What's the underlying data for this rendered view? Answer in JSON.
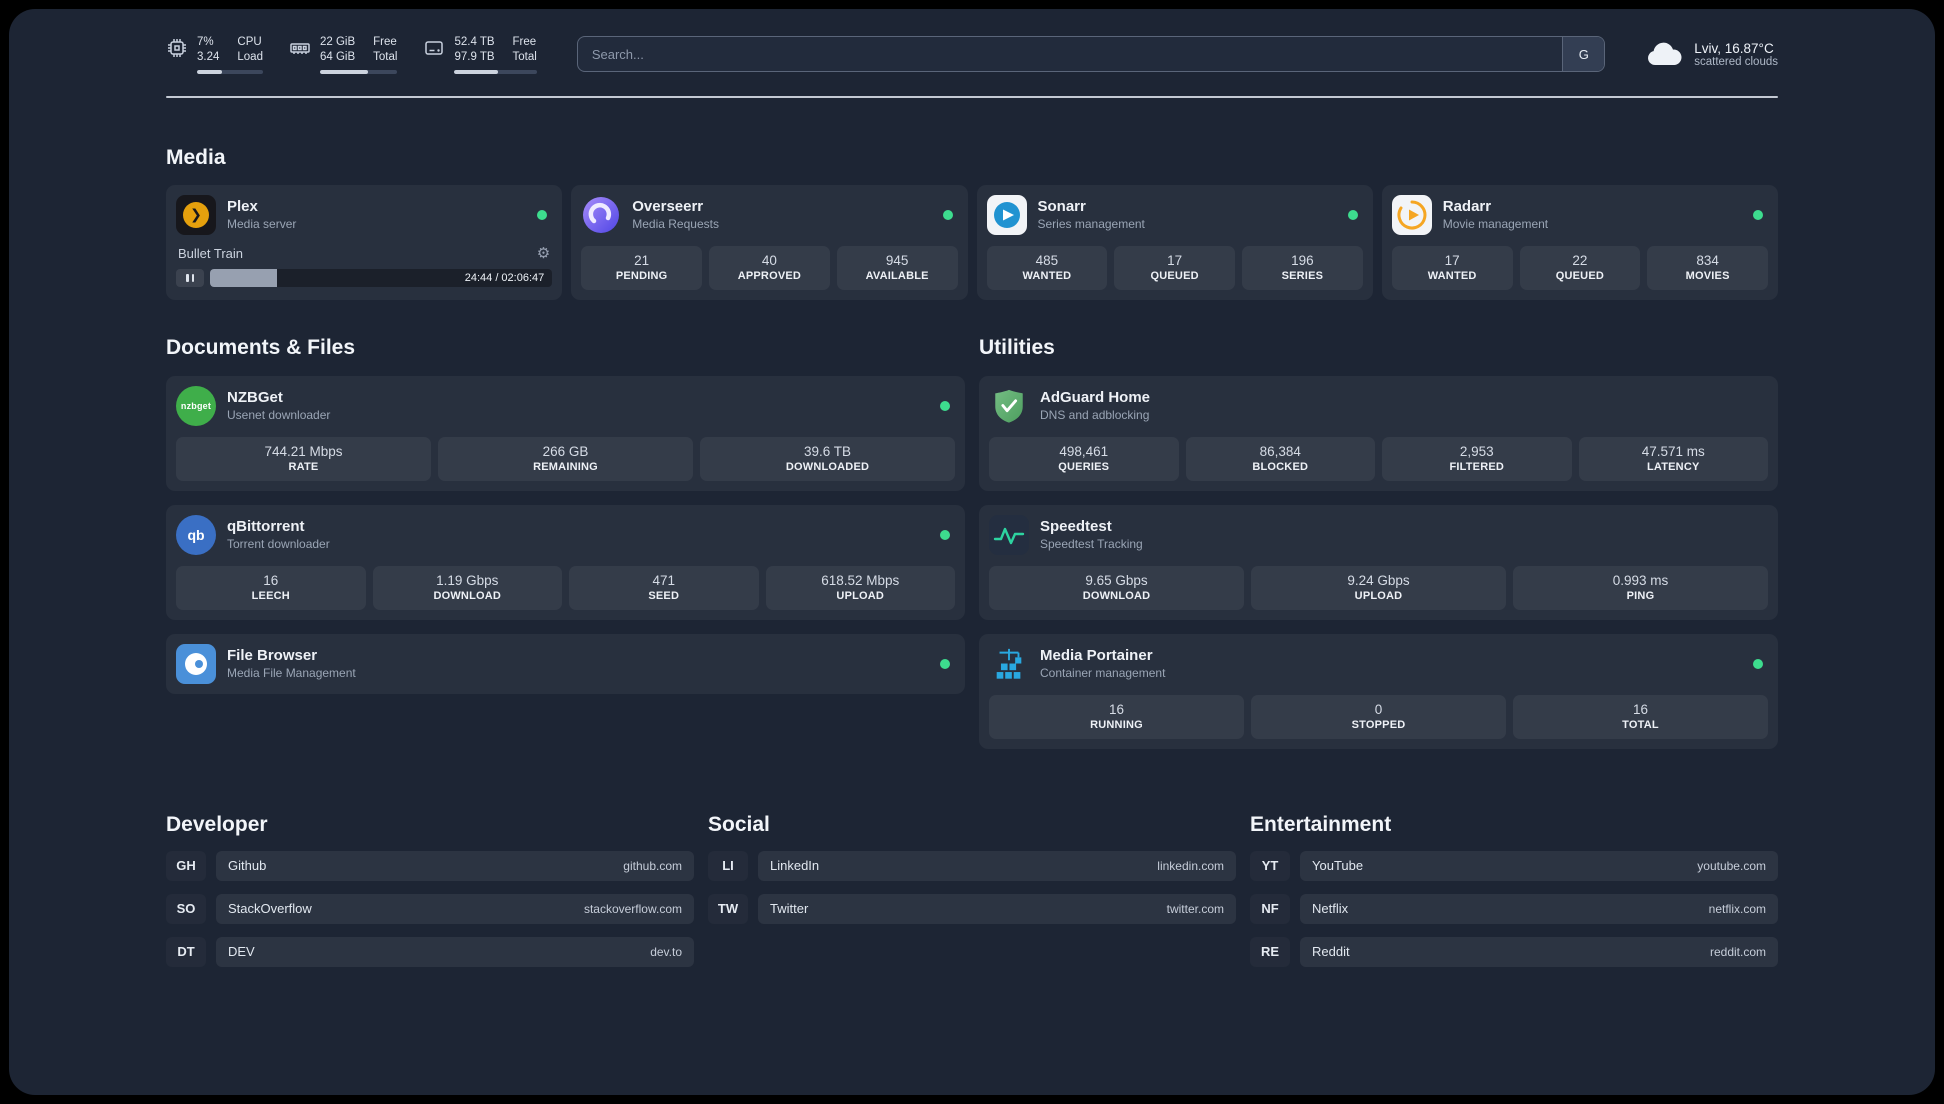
{
  "topbar": {
    "resources": [
      {
        "icon": "cpu-icon",
        "val1": "7%",
        "val2": "3.24",
        "lab1": "CPU",
        "lab2": "Load",
        "progress": 38
      },
      {
        "icon": "memory-icon",
        "val1": "22 GiB",
        "val2": "64 GiB",
        "lab1": "Free",
        "lab2": "Total",
        "progress": 62
      },
      {
        "icon": "disk-icon",
        "val1": "52.4 TB",
        "val2": "97.9 TB",
        "lab1": "Free",
        "lab2": "Total",
        "progress": 53
      }
    ],
    "search": {
      "placeholder": "Search...",
      "button_label": "G"
    },
    "weather": {
      "location": "Lviv, 16.87°C",
      "condition": "scattered clouds"
    }
  },
  "sections": {
    "media": "Media",
    "documents": "Documents & Files",
    "utilities": "Utilities"
  },
  "services": {
    "plex": {
      "name": "Plex",
      "subtitle": "Media server",
      "now_playing_title": "Bullet Train",
      "progress_time": "24:44 / 02:06:47",
      "progress_percent": 19.5
    },
    "overseerr": {
      "name": "Overseerr",
      "subtitle": "Media Requests",
      "stats": [
        {
          "value": "21",
          "label": "PENDING"
        },
        {
          "value": "40",
          "label": "APPROVED"
        },
        {
          "value": "945",
          "label": "AVAILABLE"
        }
      ]
    },
    "sonarr": {
      "name": "Sonarr",
      "subtitle": "Series management",
      "stats": [
        {
          "value": "485",
          "label": "WANTED"
        },
        {
          "value": "17",
          "label": "QUEUED"
        },
        {
          "value": "196",
          "label": "SERIES"
        }
      ]
    },
    "radarr": {
      "name": "Radarr",
      "subtitle": "Movie management",
      "stats": [
        {
          "value": "17",
          "label": "WANTED"
        },
        {
          "value": "22",
          "label": "QUEUED"
        },
        {
          "value": "834",
          "label": "MOVIES"
        }
      ]
    },
    "nzbget": {
      "name": "NZBGet",
      "subtitle": "Usenet downloader",
      "icon_text": "nzbget",
      "stats": [
        {
          "value": "744.21 Mbps",
          "label": "RATE"
        },
        {
          "value": "266 GB",
          "label": "REMAINING"
        },
        {
          "value": "39.6 TB",
          "label": "DOWNLOADED"
        }
      ]
    },
    "qbittorrent": {
      "name": "qBittorrent",
      "subtitle": "Torrent downloader",
      "icon_text": "qb",
      "stats": [
        {
          "value": "16",
          "label": "LEECH"
        },
        {
          "value": "1.19 Gbps",
          "label": "DOWNLOAD"
        },
        {
          "value": "471",
          "label": "SEED"
        },
        {
          "value": "618.52 Mbps",
          "label": "UPLOAD"
        }
      ]
    },
    "filebrowser": {
      "name": "File Browser",
      "subtitle": "Media File Management"
    },
    "adguard": {
      "name": "AdGuard Home",
      "subtitle": "DNS and adblocking",
      "stats": [
        {
          "value": "498,461",
          "label": "QUERIES"
        },
        {
          "value": "86,384",
          "label": "BLOCKED"
        },
        {
          "value": "2,953",
          "label": "FILTERED"
        },
        {
          "value": "47.571 ms",
          "label": "LATENCY"
        }
      ]
    },
    "speedtest": {
      "name": "Speedtest",
      "subtitle": "Speedtest Tracking",
      "stats": [
        {
          "value": "9.65 Gbps",
          "label": "DOWNLOAD"
        },
        {
          "value": "9.24 Gbps",
          "label": "UPLOAD"
        },
        {
          "value": "0.993 ms",
          "label": "PING"
        }
      ]
    },
    "portainer": {
      "name": "Media Portainer",
      "subtitle": "Container management",
      "stats": [
        {
          "value": "16",
          "label": "RUNNING"
        },
        {
          "value": "0",
          "label": "STOPPED"
        },
        {
          "value": "16",
          "label": "TOTAL"
        }
      ]
    }
  },
  "bookmarks": [
    {
      "title": "Developer",
      "items": [
        {
          "abbr": "GH",
          "name": "Github",
          "domain": "github.com"
        },
        {
          "abbr": "SO",
          "name": "StackOverflow",
          "domain": "stackoverflow.com"
        },
        {
          "abbr": "DT",
          "name": "DEV",
          "domain": "dev.to"
        }
      ]
    },
    {
      "title": "Social",
      "items": [
        {
          "abbr": "LI",
          "name": "LinkedIn",
          "domain": "linkedin.com"
        },
        {
          "abbr": "TW",
          "name": "Twitter",
          "domain": "twitter.com"
        }
      ]
    },
    {
      "title": "Entertainment",
      "items": [
        {
          "abbr": "YT",
          "name": "YouTube",
          "domain": "youtube.com"
        },
        {
          "abbr": "NF",
          "name": "Netflix",
          "domain": "netflix.com"
        },
        {
          "abbr": "RE",
          "name": "Reddit",
          "domain": "reddit.com"
        }
      ]
    }
  ],
  "colors": {
    "status_online": "#3ddc8e",
    "accent_amber": "#e5a00d"
  }
}
